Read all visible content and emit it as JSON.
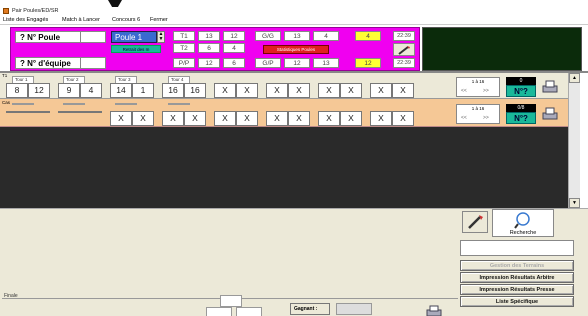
{
  "window": {
    "title": "Pair Poules/ED/SR"
  },
  "menu": [
    "Liste des Engagés",
    "Match à Lancer",
    "Concours 6",
    "Fermer"
  ],
  "poule": {
    "label": "? N° Poule",
    "select_value": "Poule 1",
    "button_label": "Retrait des m",
    "equipe_label": "? N° d'équipe"
  },
  "stats": {
    "rows": [
      {
        "code": "T1",
        "a": "13",
        "b": "12"
      },
      {
        "code": "T2",
        "a": "6",
        "b": "4"
      },
      {
        "code": "P/P",
        "a": "12",
        "b": "6"
      }
    ],
    "gg": {
      "code": "G/G",
      "a": "13",
      "b": "4",
      "c": "4"
    },
    "gp": {
      "code": "G/P",
      "a": "12",
      "b": "13",
      "c": "12"
    },
    "red_label": "Statistiques Poules",
    "times": [
      "22:39",
      "22:39"
    ]
  },
  "match_row": {
    "tour_labels": [
      "T1",
      "Tour 1",
      "Tour 2",
      "Tour 3",
      "Tour 4"
    ],
    "scores": [
      [
        "8",
        "12"
      ],
      [
        "9",
        "4"
      ],
      [
        "14",
        "1"
      ],
      [
        "16",
        "16"
      ],
      [
        "X",
        "X"
      ],
      [
        "X",
        "X"
      ],
      [
        "X",
        "X"
      ],
      [
        "X",
        "X"
      ]
    ],
    "nav_label": "1 à 16",
    "nav_prev": "<<",
    "nav_next": ">>",
    "counter": "0",
    "n_label": "N°?"
  },
  "second_row": {
    "label": "Cas",
    "scores": [
      [
        "",
        ""
      ],
      [
        "",
        ""
      ],
      [
        "X",
        "X"
      ],
      [
        "X",
        "X"
      ],
      [
        "X",
        "X"
      ],
      [
        "X",
        "X"
      ],
      [
        "X",
        "X"
      ],
      [
        "X",
        "X"
      ]
    ],
    "nav_label": "1 à 16",
    "nav_prev": "<<",
    "nav_next": ">>",
    "counter": "0/8",
    "n_label": "N°?"
  },
  "right_panel": {
    "recherche_label": "Recherche",
    "buttons": [
      "Gestion des Terrains",
      "Impression Résultats Arbitre",
      "Impression Résultats Presse",
      "Liste Spécifique"
    ]
  },
  "bottom": {
    "finale_label": "Finale",
    "gagnant_label": "Gagnant :"
  },
  "colors": {
    "magenta": "#f000f0",
    "peach": "#f5c896",
    "dark_green": "#0b2b0b",
    "teal": "#1ab89a",
    "red": "#e02020",
    "yellow": "#ffff33",
    "main_bg": "#2a2a2a",
    "selector_blue": "#3a6ad0"
  }
}
